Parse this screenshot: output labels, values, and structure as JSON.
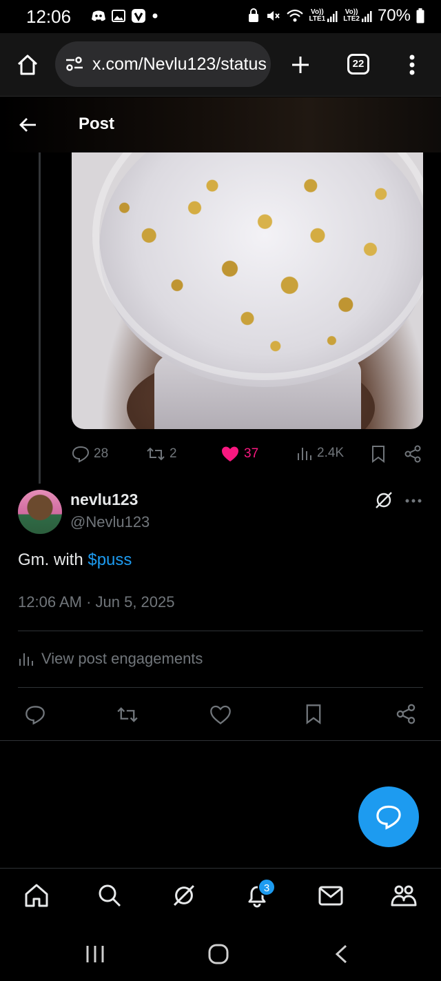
{
  "status_bar": {
    "time": "12:06",
    "battery": "70%",
    "lte1": "LTE1",
    "lte2": "LTE2",
    "vo1": "Vo))",
    "vo2": "Vo))"
  },
  "browser": {
    "url": "x.com/Nevlu123/status",
    "tab_count": "22"
  },
  "header": {
    "title": "Post"
  },
  "parent_actions": {
    "replies": "28",
    "reposts": "2",
    "likes": "37",
    "views": "2.4K"
  },
  "post": {
    "display_name": "nevlu123",
    "handle": "@Nevlu123",
    "text_prefix": "Gm. with ",
    "cashtag": "$puss",
    "timestamp": "12:06 AM · Jun 5, 2025",
    "engagements_label": "View post engagements"
  },
  "bottom_nav": {
    "notification_count": "3"
  },
  "colors": {
    "accent": "#1d9bf0",
    "like": "#f91880",
    "muted": "#71767b",
    "background": "#000000"
  },
  "icons": [
    "home-icon",
    "search-icon",
    "grok-icon",
    "bell-icon",
    "mail-icon",
    "communities-icon"
  ]
}
